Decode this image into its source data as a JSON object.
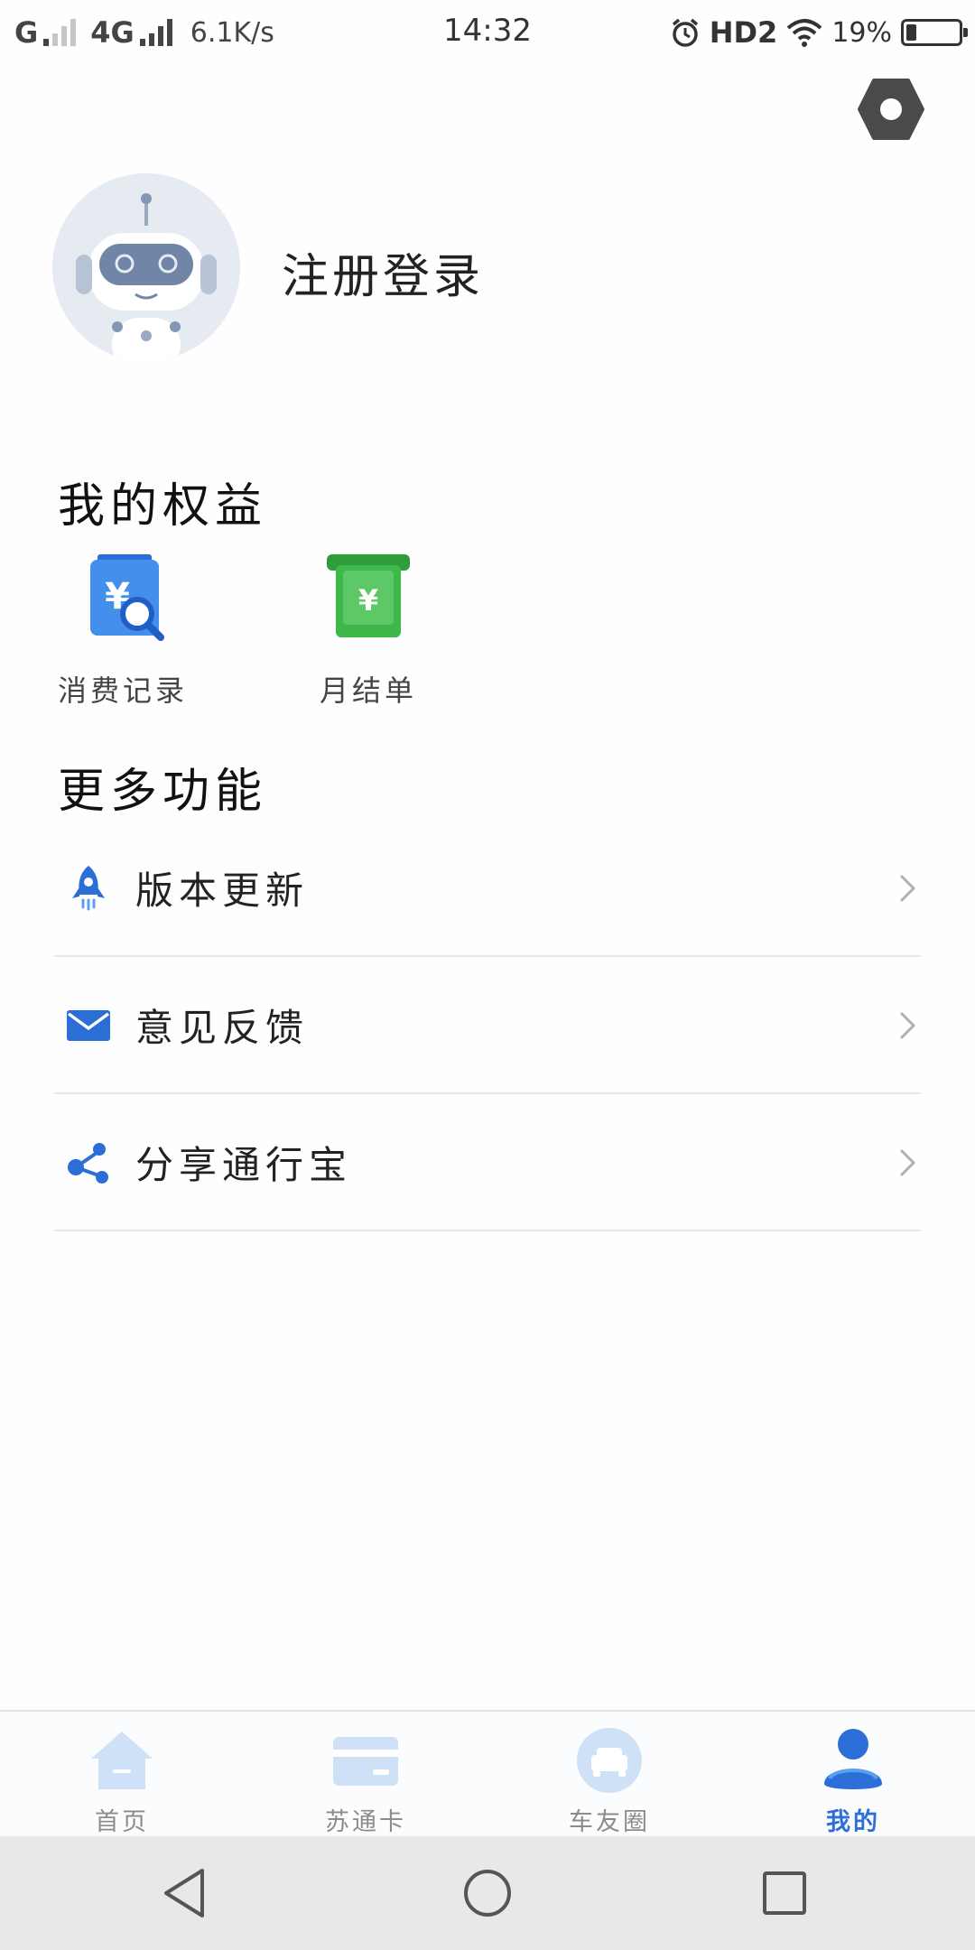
{
  "status_bar": {
    "carrier1": "G",
    "carrier2": "4G",
    "speed": "6.1K/s",
    "time": "14:32",
    "hd": "HD2",
    "battery": "19%",
    "battery_level": 0.19
  },
  "profile": {
    "login_text": "注册登录"
  },
  "rights": {
    "title": "我的权益",
    "items": [
      {
        "label": "消费记录",
        "icon": "receipt-search-icon"
      },
      {
        "label": "月结单",
        "icon": "monthly-bill-icon"
      }
    ]
  },
  "more": {
    "title": "更多功能",
    "items": [
      {
        "label": "版本更新",
        "icon": "rocket-icon"
      },
      {
        "label": "意见反馈",
        "icon": "mail-icon"
      },
      {
        "label": "分享通行宝",
        "icon": "share-icon"
      }
    ]
  },
  "tabs": [
    {
      "label": "首页",
      "icon": "home-icon",
      "active": false
    },
    {
      "label": "苏通卡",
      "icon": "card-icon",
      "active": false
    },
    {
      "label": "车友圈",
      "icon": "car-circle-icon",
      "active": false
    },
    {
      "label": "我的",
      "icon": "person-icon",
      "active": true
    }
  ],
  "colors": {
    "accent": "#2d6fd9",
    "tab_inactive": "#cfe1f6",
    "green": "#3fb84a",
    "blue_icon": "#3a86e8"
  }
}
